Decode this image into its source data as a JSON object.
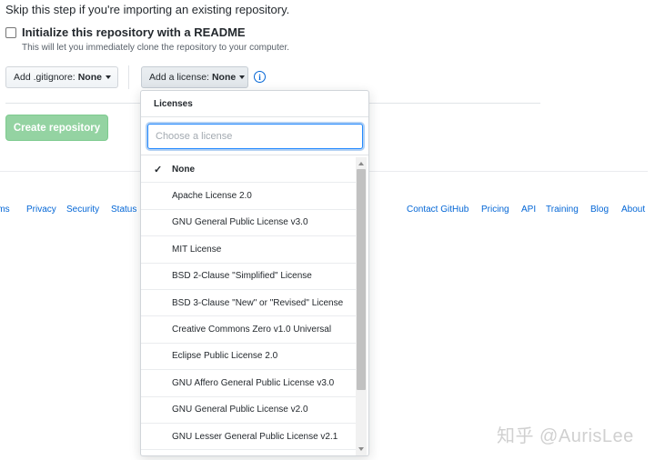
{
  "intro": {
    "skip_text": "Skip this step if you're importing an existing repository."
  },
  "readme": {
    "label": "Initialize this repository with a README",
    "note": "This will let you immediately clone the repository to your computer.",
    "checked": false
  },
  "gitignore_button": {
    "prefix": "Add .gitignore:",
    "value": "None"
  },
  "license_button": {
    "prefix": "Add a license:",
    "value": "None"
  },
  "create_button": {
    "label": "Create repository"
  },
  "license_dropdown": {
    "header": "Licenses",
    "filter_placeholder": "Choose a license",
    "selected_check": "✓",
    "items": [
      {
        "label": "None",
        "selected": true
      },
      {
        "label": "Apache License 2.0"
      },
      {
        "label": "GNU General Public License v3.0"
      },
      {
        "label": "MIT License"
      },
      {
        "label": "BSD 2-Clause \"Simplified\" License"
      },
      {
        "label": "BSD 3-Clause \"New\" or \"Revised\" License"
      },
      {
        "label": "Creative Commons Zero v1.0 Universal"
      },
      {
        "label": "Eclipse Public License 2.0"
      },
      {
        "label": "GNU Affero General Public License v3.0"
      },
      {
        "label": "GNU General Public License v2.0"
      },
      {
        "label": "GNU Lesser General Public License v2.1"
      }
    ]
  },
  "footer": {
    "left_links": [
      "rms",
      "Privacy",
      "Security",
      "Status"
    ],
    "right_links": [
      "Contact GitHub",
      "Pricing",
      "API",
      "Training",
      "Blog",
      "About"
    ]
  },
  "watermark": "知乎 @AurisLee",
  "colors": {
    "link": "#0366d6",
    "create_button_bg": "#94d3a2",
    "focus_border": "#2188ff"
  },
  "icons": {
    "info": "info-circle-icon",
    "check": "check-icon",
    "caret": "caret-down-icon"
  }
}
